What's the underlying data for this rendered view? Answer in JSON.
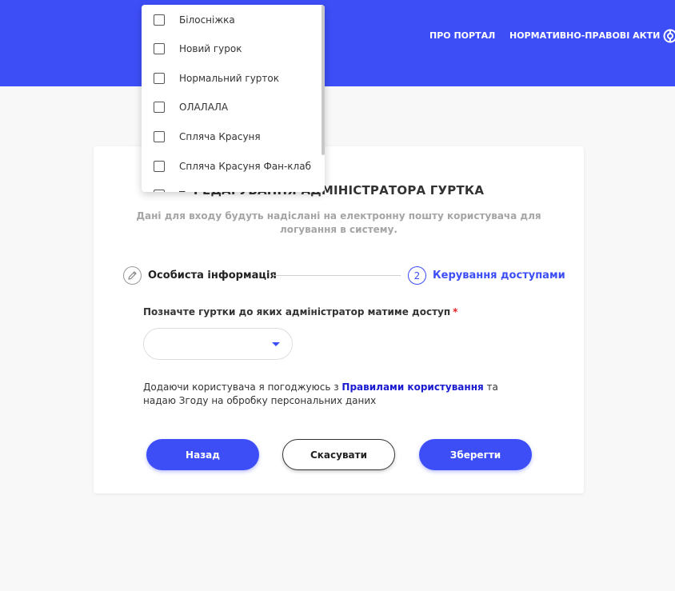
{
  "header": {
    "nav_about": "ПРО ПОРТАЛ",
    "nav_acts": "НОРМАТИВНО-ПРАВОВІ АКТИ",
    "icon": "globe-icon",
    "color": "#3d4ef7"
  },
  "card": {
    "title": "РЕДАГУВАННЯ АДМІНІСТРАТОРА ГУРТКА",
    "subtitle": "Дані для входу будуть надіслані на електронну пошту користувача для логування в систему."
  },
  "stepper": {
    "step1_label": "Особиста інформація",
    "step1_icon": "pencil-icon",
    "step2_number": "2",
    "step2_label": "Керування доступами"
  },
  "form": {
    "clubs_label": "Позначте гуртки до яких адміністратор матиме доступ",
    "required_mark": "*",
    "clubs_value": "",
    "agree_prefix": "Додаючи користувача я погоджуюсь з ",
    "agree_link": "Правилами користування",
    "agree_suffix": " та надаю Згоду на обробку персональних даних"
  },
  "buttons": {
    "back": "Назад",
    "cancel": "Скасувати",
    "save": "Зберегти"
  },
  "dropdown": {
    "items": [
      {
        "label": "Білосніжка",
        "checked": false
      },
      {
        "label": "Новий гурок",
        "checked": false
      },
      {
        "label": "Нормальний гурток",
        "checked": false
      },
      {
        "label": "ОЛАЛАЛА",
        "checked": false
      },
      {
        "label": "Спляча Красуня",
        "checked": false
      },
      {
        "label": "Спляча Красуня Фан-клаб",
        "checked": false
      },
      {
        "label": "Т",
        "checked": false
      }
    ]
  }
}
